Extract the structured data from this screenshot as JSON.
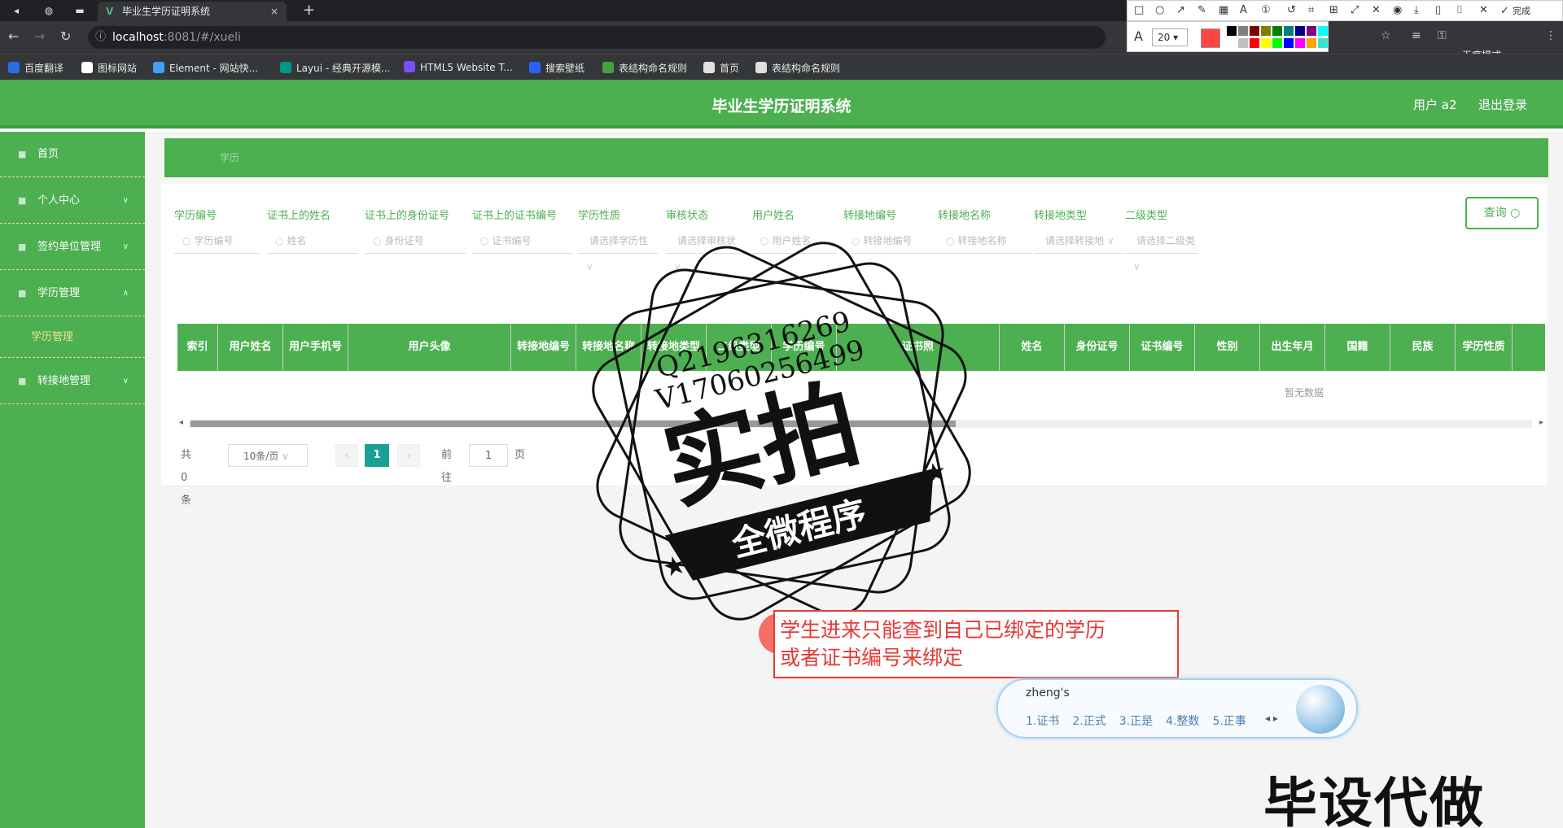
{
  "browser": {
    "tab_title": "毕业生学历证明系统",
    "tab_close": "×",
    "new_tab": "+",
    "url_host": "localhost",
    "url_path": ":8081/#/xueli",
    "incognito_label": "无痕模式",
    "bookmarks": [
      {
        "label": "百度翻译",
        "color": "#2a6ee6"
      },
      {
        "label": "图标网站",
        "color": "#ffffff"
      },
      {
        "label": "Element - 网站快...",
        "color": "#409eff"
      },
      {
        "label": "Layui - 经典开源模...",
        "color": "#009688"
      },
      {
        "label": "HTML5 Website T...",
        "color": "#7c4dff"
      },
      {
        "label": "搜索壁纸",
        "color": "#2962ff"
      },
      {
        "label": "表结构命名规则",
        "color": "#43a047"
      },
      {
        "label": "首页",
        "color": "#e0e0e0"
      },
      {
        "label": "表结构命名规则",
        "color": "#e0e0e0"
      }
    ],
    "annot_font_size": "20",
    "annot_done": "完成",
    "palette": [
      "#000000",
      "#808080",
      "#800000",
      "#808000",
      "#008000",
      "#008080",
      "#000080",
      "#800080",
      "#00ffff",
      "#ffffff",
      "#c0c0c0",
      "#ff0000",
      "#ffff00",
      "#00ff00",
      "#0000ff",
      "#ff00ff",
      "#ffa500",
      "#40e0d0"
    ]
  },
  "header": {
    "title": "毕业生学历证明系统",
    "user": "用户 a2",
    "logout": "退出登录"
  },
  "sidebar": {
    "items": [
      {
        "label": "首页"
      },
      {
        "label": "个人中心"
      },
      {
        "label": "签约单位管理"
      },
      {
        "label": "学历管理"
      },
      {
        "label": "转接地管理"
      }
    ],
    "sub_item": "学历管理"
  },
  "breadcrumb": "学历",
  "search": {
    "fields": [
      {
        "label": "学历编号",
        "placeholder": "学历编号"
      },
      {
        "label": "证书上的姓名",
        "placeholder": "姓名"
      },
      {
        "label": "证书上的身份证号",
        "placeholder": "身份证号"
      },
      {
        "label": "证书上的证书编号",
        "placeholder": "证书编号"
      },
      {
        "label": "学历性质",
        "placeholder": "请选择学历性"
      },
      {
        "label": "审核状态",
        "placeholder": "请选择审核状"
      },
      {
        "label": "用户姓名",
        "placeholder": "用户姓名"
      },
      {
        "label": "转接地编号",
        "placeholder": "转接地编号"
      },
      {
        "label": "转接地名称",
        "placeholder": "转接地名称"
      },
      {
        "label": "转接地类型",
        "placeholder": "请选择转接地"
      },
      {
        "label": "二级类型",
        "placeholder": "请选择二级类"
      }
    ],
    "query_button": "查询"
  },
  "table": {
    "columns": [
      "索引",
      "用户姓名",
      "用户手机号",
      "用户头像",
      "转接地编号",
      "转接地名称",
      "转接地类型",
      "二级类型",
      "学历编号",
      "证书照",
      "姓名",
      "身份证号",
      "证书编号",
      "性别",
      "出生年月",
      "国籍",
      "民族",
      "学历性质"
    ],
    "empty_text": "暂无数据"
  },
  "pagination": {
    "total": "共 0 条",
    "page_size": "10条/页",
    "current": "1",
    "goto_label": "前往",
    "goto_value": "1",
    "page_suffix": "页"
  },
  "watermark": {
    "qq": "Q2196316269",
    "phone": "V17060256499",
    "big": "实拍",
    "ribbon": "全微程序"
  },
  "note": {
    "line1": "学生进来只能查到自己已绑定的学历",
    "line2": "或者证书编号来绑定"
  },
  "ime": {
    "pinyin": "zheng's",
    "candidates": [
      "1.证书",
      "2.正式",
      "3.正是",
      "4.整数",
      "5.正事"
    ]
  },
  "ad_text": "毕设代做"
}
